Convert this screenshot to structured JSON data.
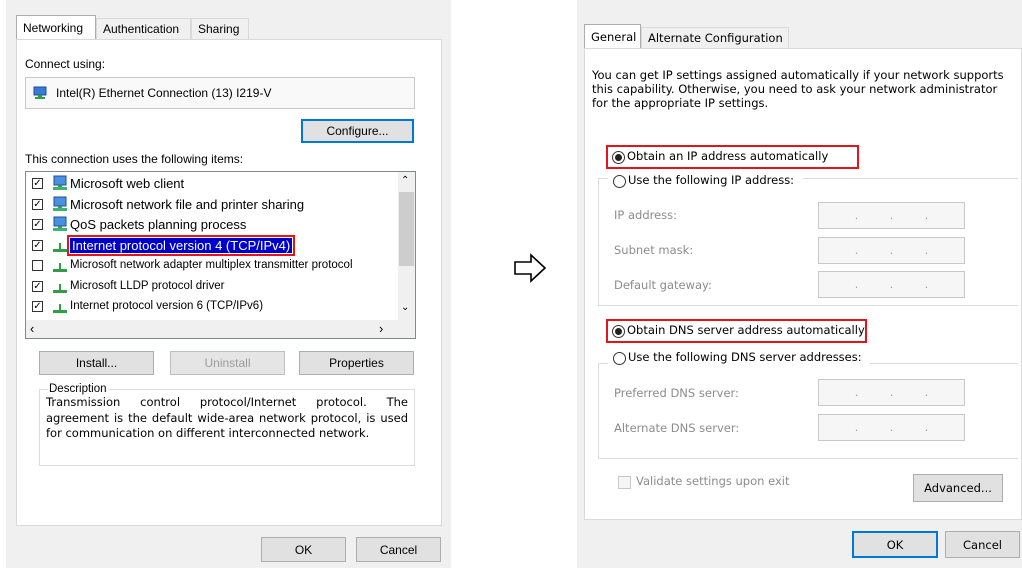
{
  "left_dialog": {
    "tabs": [
      "Networking",
      "Authentication",
      "Sharing"
    ],
    "connect_using_label": "Connect using:",
    "adapter_name": "Intel(R) Ethernet Connection (13) I219-V",
    "configure_button": "Configure...",
    "items_label": "This connection uses the following items:",
    "items": [
      {
        "label": "Microsoft web client",
        "checked": true,
        "icon": "network-client-icon"
      },
      {
        "label": "Microsoft network file and printer sharing",
        "checked": true,
        "icon": "network-client-icon"
      },
      {
        "label": "QoS packets planning process",
        "checked": true,
        "icon": "network-client-icon"
      },
      {
        "label": "Internet protocol version 4 (TCP/IPv4)",
        "checked": true,
        "icon": "protocol-icon",
        "selected": true
      },
      {
        "label": "Microsoft network adapter multiplex transmitter protocol",
        "checked": false,
        "icon": "protocol-icon"
      },
      {
        "label": "Microsoft LLDP protocol driver",
        "checked": true,
        "icon": "protocol-icon"
      },
      {
        "label": "Internet protocol version 6 (TCP/IPv6)",
        "checked": true,
        "icon": "protocol-icon"
      }
    ],
    "install_button": "Install...",
    "uninstall_button": "Uninstall",
    "properties_button": "Properties",
    "description_label": "Description",
    "description_text": "Transmission control protocol/Internet protocol. The agreement is the default wide-area network protocol, is used for communication on different interconnected network.",
    "ok_button": "OK",
    "cancel_button": "Cancel"
  },
  "arrow_icon": "arrow-right-outline-icon",
  "right_dialog": {
    "tabs": [
      "General",
      "Alternate Configuration"
    ],
    "intro_text": "You can get IP settings assigned automatically if your network supports this capability. Otherwise, you need to ask your network administrator for the appropriate IP settings.",
    "obtain_ip_auto": "Obtain an IP address automatically",
    "use_following_ip": "Use the following IP address:",
    "ip_address_label": "IP address:",
    "subnet_mask_label": "Subnet mask:",
    "default_gateway_label": "Default gateway:",
    "obtain_dns_auto": "Obtain DNS server address automatically",
    "use_following_dns": "Use the following DNS server addresses:",
    "preferred_dns_label": "Preferred DNS server:",
    "alternate_dns_label": "Alternate DNS server:",
    "ip_dots": ". . .",
    "validate_label": "Validate settings upon exit",
    "advanced_button": "Advanced...",
    "ok_button": "OK",
    "cancel_button": "Cancel"
  },
  "colors": {
    "highlight": "#e3151a",
    "selection": "#0000cc",
    "focus": "#0078d7"
  }
}
